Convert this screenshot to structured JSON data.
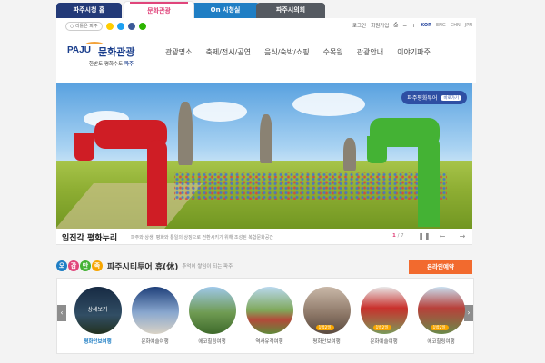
{
  "site_tabs": [
    "파주시청 홈",
    "문화관광",
    "On 시청실",
    "파주시의회"
  ],
  "utility": {
    "kids": "○ 리틀은 파주",
    "login": "로그인",
    "join": "회원가입",
    "languages": [
      "KOR",
      "ENG",
      "CHN",
      "JPN"
    ]
  },
  "logo": {
    "en": "PAJU",
    "ko": "문화관광",
    "sub_prefix": "한반도 평화수도 ",
    "sub_city": "파주"
  },
  "gnb": [
    "관광명소",
    "축제/전시/공연",
    "음식/숙박/쇼핑",
    "수목원",
    "관광안내",
    "이야기파주"
  ],
  "hero": {
    "badge": "파주평화투어",
    "badge_shortcut": "바로가기",
    "title": "임진각 평화누리",
    "description": "파주와 상생, 평화와 통일의 상징으로 전환시키기 위해 조성된 복합문화공간",
    "counter_current": "1",
    "counter_total": " / 7",
    "prev": "←",
    "next": "→",
    "pause": "❚❚"
  },
  "tour": {
    "circles": [
      "오",
      "감",
      "만",
      "족"
    ],
    "title": "파주시티투어 휴(休)",
    "subtitle": "추억이 쌓임이 되는 파주",
    "reserve": "온라인예약",
    "prev": "‹",
    "next": "›",
    "items": [
      {
        "label": "평화안보여행",
        "overlay": "상세보기"
      },
      {
        "label": "문화예술여행"
      },
      {
        "label": "에코힐링여행"
      },
      {
        "label": "역사유적여행"
      },
      {
        "label": "평화안보여행",
        "pill": "1박2일"
      },
      {
        "label": "문화예술여행",
        "pill": "1박2일"
      },
      {
        "label": "에코힐링여행",
        "pill": "1박2일"
      }
    ]
  },
  "colors": {
    "culture_tab": "#e0457b",
    "city_tab": "#233a78",
    "online_tab": "#1f7ec4",
    "council_tab": "#555a61",
    "reserve": "#f26a2e",
    "brand": "#1a3e8c"
  }
}
